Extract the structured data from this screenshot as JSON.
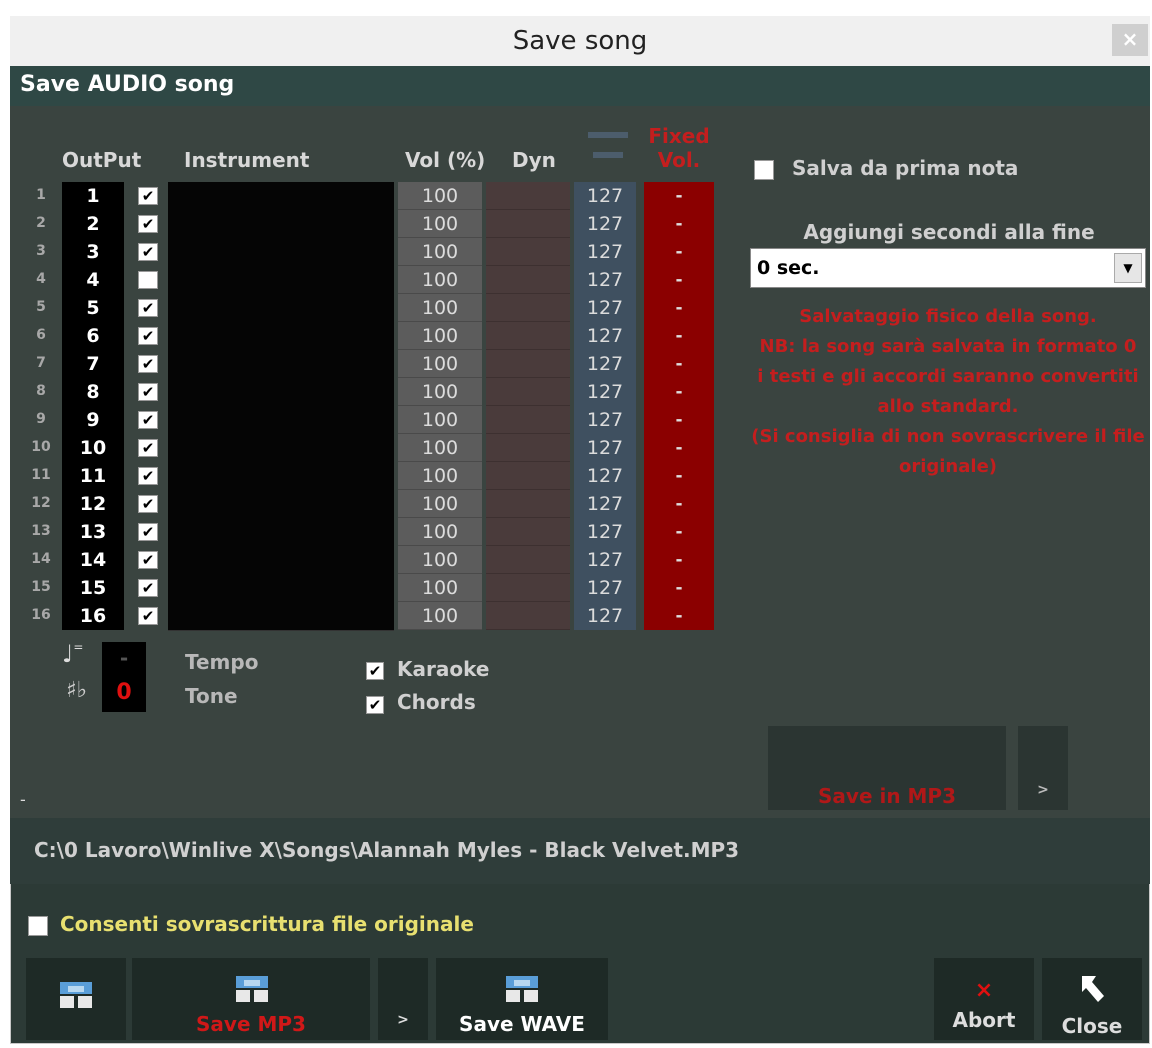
{
  "window": {
    "title": "Save song",
    "close_label": "×"
  },
  "header": {
    "title": "Save AUDIO song"
  },
  "table": {
    "headers": {
      "output": "OutPut",
      "instrument": "Instrument",
      "vol": "Vol (%)",
      "dyn": "Dyn",
      "fixed": "Fixed\nVol."
    },
    "rows": [
      {
        "n": "1",
        "out": "1",
        "checked": true,
        "vol": "100",
        "vel": "127",
        "fixed": "-"
      },
      {
        "n": "2",
        "out": "2",
        "checked": true,
        "vol": "100",
        "vel": "127",
        "fixed": "-"
      },
      {
        "n": "3",
        "out": "3",
        "checked": true,
        "vol": "100",
        "vel": "127",
        "fixed": "-"
      },
      {
        "n": "4",
        "out": "4",
        "checked": false,
        "vol": "100",
        "vel": "127",
        "fixed": "-"
      },
      {
        "n": "5",
        "out": "5",
        "checked": true,
        "vol": "100",
        "vel": "127",
        "fixed": "-"
      },
      {
        "n": "6",
        "out": "6",
        "checked": true,
        "vol": "100",
        "vel": "127",
        "fixed": "-"
      },
      {
        "n": "7",
        "out": "7",
        "checked": true,
        "vol": "100",
        "vel": "127",
        "fixed": "-"
      },
      {
        "n": "8",
        "out": "8",
        "checked": true,
        "vol": "100",
        "vel": "127",
        "fixed": "-"
      },
      {
        "n": "9",
        "out": "9",
        "checked": true,
        "vol": "100",
        "vel": "127",
        "fixed": "-"
      },
      {
        "n": "10",
        "out": "10",
        "checked": true,
        "vol": "100",
        "vel": "127",
        "fixed": "-"
      },
      {
        "n": "11",
        "out": "11",
        "checked": true,
        "vol": "100",
        "vel": "127",
        "fixed": "-"
      },
      {
        "n": "12",
        "out": "12",
        "checked": true,
        "vol": "100",
        "vel": "127",
        "fixed": "-"
      },
      {
        "n": "13",
        "out": "13",
        "checked": true,
        "vol": "100",
        "vel": "127",
        "fixed": "-"
      },
      {
        "n": "14",
        "out": "14",
        "checked": true,
        "vol": "100",
        "vel": "127",
        "fixed": "-"
      },
      {
        "n": "15",
        "out": "15",
        "checked": true,
        "vol": "100",
        "vel": "127",
        "fixed": "-"
      },
      {
        "n": "16",
        "out": "16",
        "checked": true,
        "vol": "100",
        "vel": "127",
        "fixed": "-"
      }
    ]
  },
  "tempo": {
    "value": "-",
    "label": "Tempo"
  },
  "tone": {
    "value": "0",
    "label": "Tone"
  },
  "options": {
    "karaoke": {
      "label": "Karaoke",
      "checked": true
    },
    "chords": {
      "label": "Chords",
      "checked": true
    }
  },
  "right": {
    "salva_label": "Salva da prima nota",
    "aggiungi_label": "Aggiungi secondi alla fine",
    "seconds_value": "0 sec.",
    "note_lines": [
      "Salvataggio fisico della song.",
      "NB: la song sarà salvata in formato 0",
      "i testi e gli accordi saranno convertiti",
      "allo standard.",
      "(Si consiglia di non sovrascrivere il file",
      "originale)"
    ],
    "save_in_mp3": "Save in MP3",
    "more_label": ">"
  },
  "status_dash": "-",
  "path": "C:\\0 Lavoro\\Winlive X\\Songs\\Alannah Myles - Black Velvet.MP3",
  "overwrite_label": "Consenti sovrascrittura file originale",
  "bottom": {
    "save_mp3": "Save MP3",
    "more": ">",
    "save_wave": "Save WAVE",
    "abort": "Abort",
    "abort_icon": "×",
    "close": "Close"
  },
  "colors": {
    "accent_red": "#c41e1e",
    "fixed_bg": "#8b0000",
    "overwrite_yellow": "#e8e070"
  }
}
